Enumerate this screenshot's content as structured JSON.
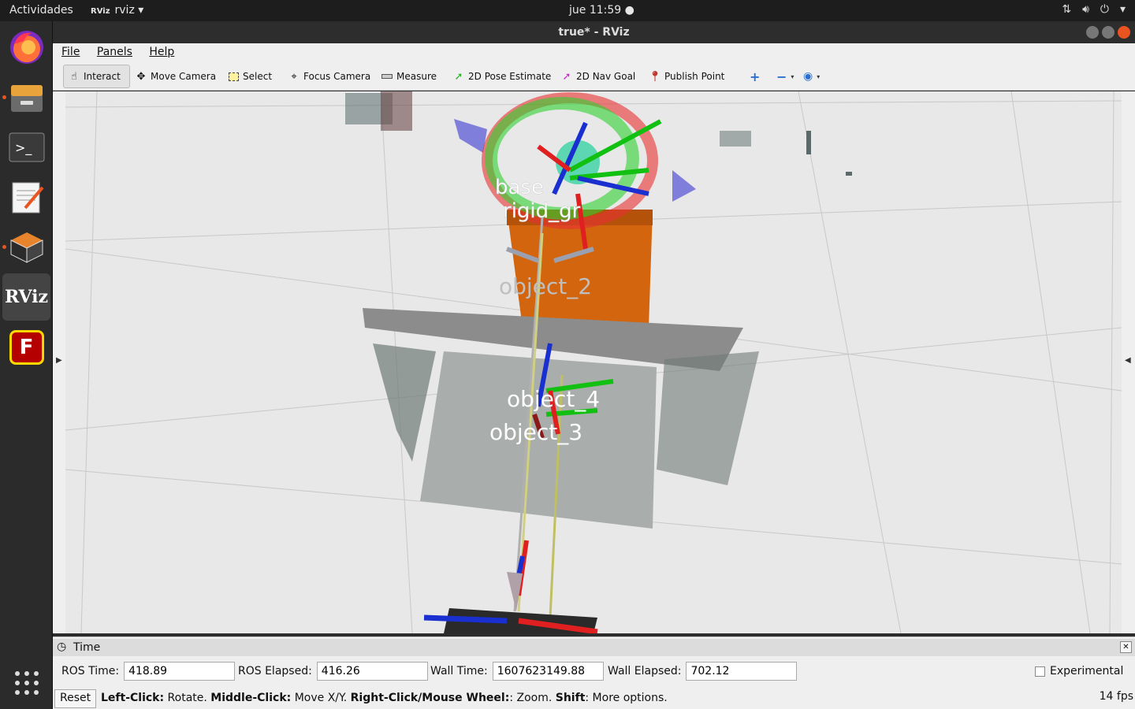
{
  "topbar": {
    "activities": "Actividades",
    "app_logo": "RViz",
    "app_name": "rviz",
    "app_menu_icon": "chevron-down-icon",
    "clock": "jue 11:59",
    "tray_icons": [
      "network-icon",
      "volume-icon",
      "power-icon",
      "chevron-down-icon"
    ]
  },
  "dock": {
    "items": [
      "firefox-icon",
      "files-icon",
      "terminal-icon",
      "text-editor-icon",
      "blender-icon",
      "rviz-icon",
      "filezilla-icon",
      "app-grid-icon"
    ],
    "rviz_label": "RViz",
    "filezilla_label": "F"
  },
  "window": {
    "title": "true* - RViz",
    "menu": {
      "file": "File",
      "panels": "Panels",
      "help": "Help"
    }
  },
  "toolbar": {
    "interact": "Interact",
    "move_camera": "Move Camera",
    "select": "Select",
    "focus_camera": "Focus Camera",
    "measure": "Measure",
    "pose_estimate": "2D Pose Estimate",
    "nav_goal": "2D Nav Goal",
    "publish_point": "Publish Point",
    "add_tool": "+",
    "remove_tool": "−",
    "view_tool": "eye-icon"
  },
  "scene": {
    "labels": [
      "object_2",
      "object_4",
      "object_3"
    ],
    "frame_labels": [
      "base",
      "rigid_gr"
    ]
  },
  "time_panel": {
    "title": "Time",
    "ros_time_label": "ROS Time:",
    "ros_time": "418.89",
    "ros_elapsed_label": "ROS Elapsed:",
    "ros_elapsed": "416.26",
    "wall_time_label": "Wall Time:",
    "wall_time": "1607623149.88",
    "wall_elapsed_label": "Wall Elapsed:",
    "wall_elapsed": "702.12",
    "experimental_label": "Experimental",
    "experimental_checked": false
  },
  "status": {
    "reset": "Reset",
    "hint_left_key": "Left-Click:",
    "hint_left": " Rotate. ",
    "hint_middle_key": "Middle-Click:",
    "hint_middle": " Move X/Y. ",
    "hint_right_key": "Right-Click/Mouse Wheel:",
    "hint_right": ": Zoom. ",
    "hint_shift_key": "Shift",
    "hint_shift": ": More options.",
    "fps": "14 fps"
  }
}
